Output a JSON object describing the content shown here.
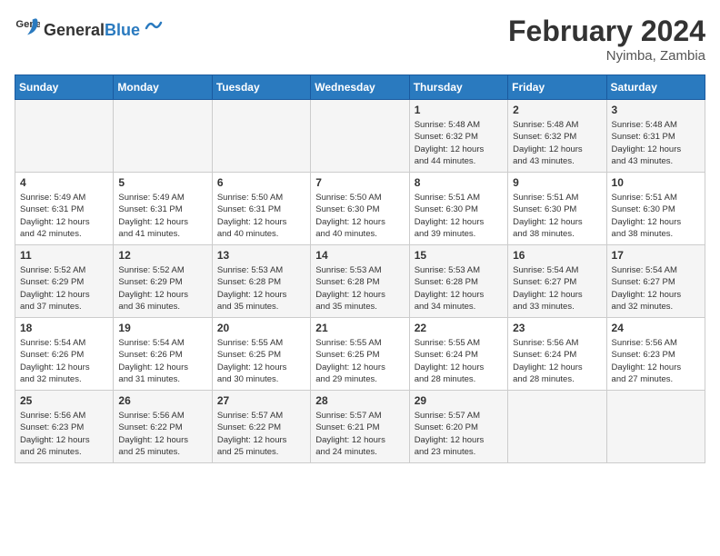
{
  "logo": {
    "text_general": "General",
    "text_blue": "Blue"
  },
  "header": {
    "month_year": "February 2024",
    "location": "Nyimba, Zambia"
  },
  "days_of_week": [
    "Sunday",
    "Monday",
    "Tuesday",
    "Wednesday",
    "Thursday",
    "Friday",
    "Saturday"
  ],
  "weeks": [
    [
      {
        "day": "",
        "info": ""
      },
      {
        "day": "",
        "info": ""
      },
      {
        "day": "",
        "info": ""
      },
      {
        "day": "",
        "info": ""
      },
      {
        "day": "1",
        "info": "Sunrise: 5:48 AM\nSunset: 6:32 PM\nDaylight: 12 hours\nand 44 minutes."
      },
      {
        "day": "2",
        "info": "Sunrise: 5:48 AM\nSunset: 6:32 PM\nDaylight: 12 hours\nand 43 minutes."
      },
      {
        "day": "3",
        "info": "Sunrise: 5:48 AM\nSunset: 6:31 PM\nDaylight: 12 hours\nand 43 minutes."
      }
    ],
    [
      {
        "day": "4",
        "info": "Sunrise: 5:49 AM\nSunset: 6:31 PM\nDaylight: 12 hours\nand 42 minutes."
      },
      {
        "day": "5",
        "info": "Sunrise: 5:49 AM\nSunset: 6:31 PM\nDaylight: 12 hours\nand 41 minutes."
      },
      {
        "day": "6",
        "info": "Sunrise: 5:50 AM\nSunset: 6:31 PM\nDaylight: 12 hours\nand 40 minutes."
      },
      {
        "day": "7",
        "info": "Sunrise: 5:50 AM\nSunset: 6:30 PM\nDaylight: 12 hours\nand 40 minutes."
      },
      {
        "day": "8",
        "info": "Sunrise: 5:51 AM\nSunset: 6:30 PM\nDaylight: 12 hours\nand 39 minutes."
      },
      {
        "day": "9",
        "info": "Sunrise: 5:51 AM\nSunset: 6:30 PM\nDaylight: 12 hours\nand 38 minutes."
      },
      {
        "day": "10",
        "info": "Sunrise: 5:51 AM\nSunset: 6:30 PM\nDaylight: 12 hours\nand 38 minutes."
      }
    ],
    [
      {
        "day": "11",
        "info": "Sunrise: 5:52 AM\nSunset: 6:29 PM\nDaylight: 12 hours\nand 37 minutes."
      },
      {
        "day": "12",
        "info": "Sunrise: 5:52 AM\nSunset: 6:29 PM\nDaylight: 12 hours\nand 36 minutes."
      },
      {
        "day": "13",
        "info": "Sunrise: 5:53 AM\nSunset: 6:28 PM\nDaylight: 12 hours\nand 35 minutes."
      },
      {
        "day": "14",
        "info": "Sunrise: 5:53 AM\nSunset: 6:28 PM\nDaylight: 12 hours\nand 35 minutes."
      },
      {
        "day": "15",
        "info": "Sunrise: 5:53 AM\nSunset: 6:28 PM\nDaylight: 12 hours\nand 34 minutes."
      },
      {
        "day": "16",
        "info": "Sunrise: 5:54 AM\nSunset: 6:27 PM\nDaylight: 12 hours\nand 33 minutes."
      },
      {
        "day": "17",
        "info": "Sunrise: 5:54 AM\nSunset: 6:27 PM\nDaylight: 12 hours\nand 32 minutes."
      }
    ],
    [
      {
        "day": "18",
        "info": "Sunrise: 5:54 AM\nSunset: 6:26 PM\nDaylight: 12 hours\nand 32 minutes."
      },
      {
        "day": "19",
        "info": "Sunrise: 5:54 AM\nSunset: 6:26 PM\nDaylight: 12 hours\nand 31 minutes."
      },
      {
        "day": "20",
        "info": "Sunrise: 5:55 AM\nSunset: 6:25 PM\nDaylight: 12 hours\nand 30 minutes."
      },
      {
        "day": "21",
        "info": "Sunrise: 5:55 AM\nSunset: 6:25 PM\nDaylight: 12 hours\nand 29 minutes."
      },
      {
        "day": "22",
        "info": "Sunrise: 5:55 AM\nSunset: 6:24 PM\nDaylight: 12 hours\nand 28 minutes."
      },
      {
        "day": "23",
        "info": "Sunrise: 5:56 AM\nSunset: 6:24 PM\nDaylight: 12 hours\nand 28 minutes."
      },
      {
        "day": "24",
        "info": "Sunrise: 5:56 AM\nSunset: 6:23 PM\nDaylight: 12 hours\nand 27 minutes."
      }
    ],
    [
      {
        "day": "25",
        "info": "Sunrise: 5:56 AM\nSunset: 6:23 PM\nDaylight: 12 hours\nand 26 minutes."
      },
      {
        "day": "26",
        "info": "Sunrise: 5:56 AM\nSunset: 6:22 PM\nDaylight: 12 hours\nand 25 minutes."
      },
      {
        "day": "27",
        "info": "Sunrise: 5:57 AM\nSunset: 6:22 PM\nDaylight: 12 hours\nand 25 minutes."
      },
      {
        "day": "28",
        "info": "Sunrise: 5:57 AM\nSunset: 6:21 PM\nDaylight: 12 hours\nand 24 minutes."
      },
      {
        "day": "29",
        "info": "Sunrise: 5:57 AM\nSunset: 6:20 PM\nDaylight: 12 hours\nand 23 minutes."
      },
      {
        "day": "",
        "info": ""
      },
      {
        "day": "",
        "info": ""
      }
    ]
  ]
}
